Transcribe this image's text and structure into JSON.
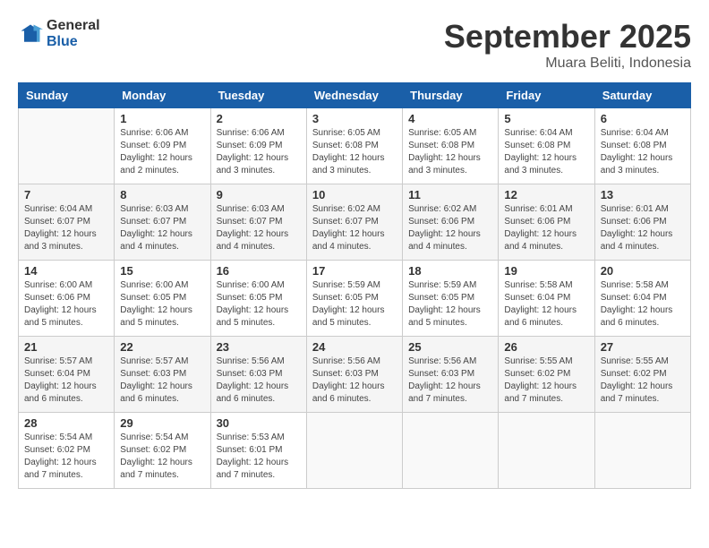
{
  "logo": {
    "general": "General",
    "blue": "Blue"
  },
  "title": {
    "month": "September 2025",
    "location": "Muara Beliti, Indonesia"
  },
  "headers": [
    "Sunday",
    "Monday",
    "Tuesday",
    "Wednesday",
    "Thursday",
    "Friday",
    "Saturday"
  ],
  "weeks": [
    [
      {
        "day": "",
        "info": ""
      },
      {
        "day": "1",
        "info": "Sunrise: 6:06 AM\nSunset: 6:09 PM\nDaylight: 12 hours\nand 2 minutes."
      },
      {
        "day": "2",
        "info": "Sunrise: 6:06 AM\nSunset: 6:09 PM\nDaylight: 12 hours\nand 3 minutes."
      },
      {
        "day": "3",
        "info": "Sunrise: 6:05 AM\nSunset: 6:08 PM\nDaylight: 12 hours\nand 3 minutes."
      },
      {
        "day": "4",
        "info": "Sunrise: 6:05 AM\nSunset: 6:08 PM\nDaylight: 12 hours\nand 3 minutes."
      },
      {
        "day": "5",
        "info": "Sunrise: 6:04 AM\nSunset: 6:08 PM\nDaylight: 12 hours\nand 3 minutes."
      },
      {
        "day": "6",
        "info": "Sunrise: 6:04 AM\nSunset: 6:08 PM\nDaylight: 12 hours\nand 3 minutes."
      }
    ],
    [
      {
        "day": "7",
        "info": "Sunrise: 6:04 AM\nSunset: 6:07 PM\nDaylight: 12 hours\nand 3 minutes."
      },
      {
        "day": "8",
        "info": "Sunrise: 6:03 AM\nSunset: 6:07 PM\nDaylight: 12 hours\nand 4 minutes."
      },
      {
        "day": "9",
        "info": "Sunrise: 6:03 AM\nSunset: 6:07 PM\nDaylight: 12 hours\nand 4 minutes."
      },
      {
        "day": "10",
        "info": "Sunrise: 6:02 AM\nSunset: 6:07 PM\nDaylight: 12 hours\nand 4 minutes."
      },
      {
        "day": "11",
        "info": "Sunrise: 6:02 AM\nSunset: 6:06 PM\nDaylight: 12 hours\nand 4 minutes."
      },
      {
        "day": "12",
        "info": "Sunrise: 6:01 AM\nSunset: 6:06 PM\nDaylight: 12 hours\nand 4 minutes."
      },
      {
        "day": "13",
        "info": "Sunrise: 6:01 AM\nSunset: 6:06 PM\nDaylight: 12 hours\nand 4 minutes."
      }
    ],
    [
      {
        "day": "14",
        "info": "Sunrise: 6:00 AM\nSunset: 6:06 PM\nDaylight: 12 hours\nand 5 minutes."
      },
      {
        "day": "15",
        "info": "Sunrise: 6:00 AM\nSunset: 6:05 PM\nDaylight: 12 hours\nand 5 minutes."
      },
      {
        "day": "16",
        "info": "Sunrise: 6:00 AM\nSunset: 6:05 PM\nDaylight: 12 hours\nand 5 minutes."
      },
      {
        "day": "17",
        "info": "Sunrise: 5:59 AM\nSunset: 6:05 PM\nDaylight: 12 hours\nand 5 minutes."
      },
      {
        "day": "18",
        "info": "Sunrise: 5:59 AM\nSunset: 6:05 PM\nDaylight: 12 hours\nand 5 minutes."
      },
      {
        "day": "19",
        "info": "Sunrise: 5:58 AM\nSunset: 6:04 PM\nDaylight: 12 hours\nand 6 minutes."
      },
      {
        "day": "20",
        "info": "Sunrise: 5:58 AM\nSunset: 6:04 PM\nDaylight: 12 hours\nand 6 minutes."
      }
    ],
    [
      {
        "day": "21",
        "info": "Sunrise: 5:57 AM\nSunset: 6:04 PM\nDaylight: 12 hours\nand 6 minutes."
      },
      {
        "day": "22",
        "info": "Sunrise: 5:57 AM\nSunset: 6:03 PM\nDaylight: 12 hours\nand 6 minutes."
      },
      {
        "day": "23",
        "info": "Sunrise: 5:56 AM\nSunset: 6:03 PM\nDaylight: 12 hours\nand 6 minutes."
      },
      {
        "day": "24",
        "info": "Sunrise: 5:56 AM\nSunset: 6:03 PM\nDaylight: 12 hours\nand 6 minutes."
      },
      {
        "day": "25",
        "info": "Sunrise: 5:56 AM\nSunset: 6:03 PM\nDaylight: 12 hours\nand 7 minutes."
      },
      {
        "day": "26",
        "info": "Sunrise: 5:55 AM\nSunset: 6:02 PM\nDaylight: 12 hours\nand 7 minutes."
      },
      {
        "day": "27",
        "info": "Sunrise: 5:55 AM\nSunset: 6:02 PM\nDaylight: 12 hours\nand 7 minutes."
      }
    ],
    [
      {
        "day": "28",
        "info": "Sunrise: 5:54 AM\nSunset: 6:02 PM\nDaylight: 12 hours\nand 7 minutes."
      },
      {
        "day": "29",
        "info": "Sunrise: 5:54 AM\nSunset: 6:02 PM\nDaylight: 12 hours\nand 7 minutes."
      },
      {
        "day": "30",
        "info": "Sunrise: 5:53 AM\nSunset: 6:01 PM\nDaylight: 12 hours\nand 7 minutes."
      },
      {
        "day": "",
        "info": ""
      },
      {
        "day": "",
        "info": ""
      },
      {
        "day": "",
        "info": ""
      },
      {
        "day": "",
        "info": ""
      }
    ]
  ]
}
